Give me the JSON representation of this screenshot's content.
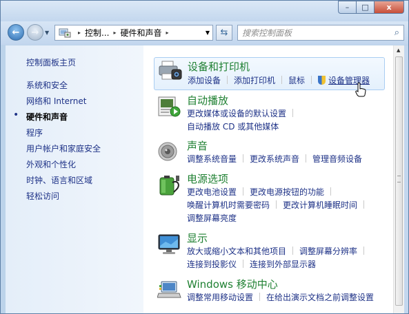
{
  "window": {
    "caption_buttons": {
      "minimize": "–",
      "maximize": "□",
      "close": "x"
    }
  },
  "nav": {
    "back_glyph": "←",
    "forward_glyph": "→",
    "breadcrumb": [
      "控制...",
      "硬件和声音"
    ],
    "separator": "▸",
    "search_placeholder": "搜索控制面板"
  },
  "sidebar": {
    "home": "控制面板主页",
    "items": [
      {
        "label": "系统和安全"
      },
      {
        "label": "网络和 Internet"
      },
      {
        "label": "硬件和声音",
        "current": true
      },
      {
        "label": "程序"
      },
      {
        "label": "用户帐户和家庭安全"
      },
      {
        "label": "外观和个性化"
      },
      {
        "label": "时钟、语言和区域"
      },
      {
        "label": "轻松访问"
      }
    ]
  },
  "categories": [
    {
      "title": "设备和打印机",
      "icon": "printer-icon",
      "rows": [
        [
          "添加设备",
          "添加打印机",
          "鼠标",
          "设备管理器"
        ]
      ]
    },
    {
      "title": "自动播放",
      "icon": "autoplay-icon",
      "rows": [
        [
          "更改媒体或设备的默认设置"
        ],
        [
          "自动播放 CD 或其他媒体"
        ]
      ]
    },
    {
      "title": "声音",
      "icon": "speaker-icon",
      "rows": [
        [
          "调整系统音量",
          "更改系统声音",
          "管理音频设备"
        ]
      ]
    },
    {
      "title": "电源选项",
      "icon": "battery-icon",
      "rows": [
        [
          "更改电池设置",
          "更改电源按钮的功能"
        ],
        [
          "唤醒计算机时需要密码",
          "更改计算机睡眠时间"
        ],
        [
          "调整屏幕亮度"
        ]
      ]
    },
    {
      "title": "显示",
      "icon": "monitor-icon",
      "rows": [
        [
          "放大或缩小文本和其他项目",
          "调整屏幕分辨率"
        ],
        [
          "连接到投影仪",
          "连接到外部显示器"
        ]
      ]
    },
    {
      "title": "Windows 移动中心",
      "icon": "mobility-center-icon",
      "rows": [
        [
          "调整常用移动设置",
          "在给出演示文档之前调整设置"
        ]
      ]
    }
  ],
  "colors": {
    "category_title": "#1f8032",
    "link": "#1e3287",
    "hover_border": "#a9cdf2"
  }
}
